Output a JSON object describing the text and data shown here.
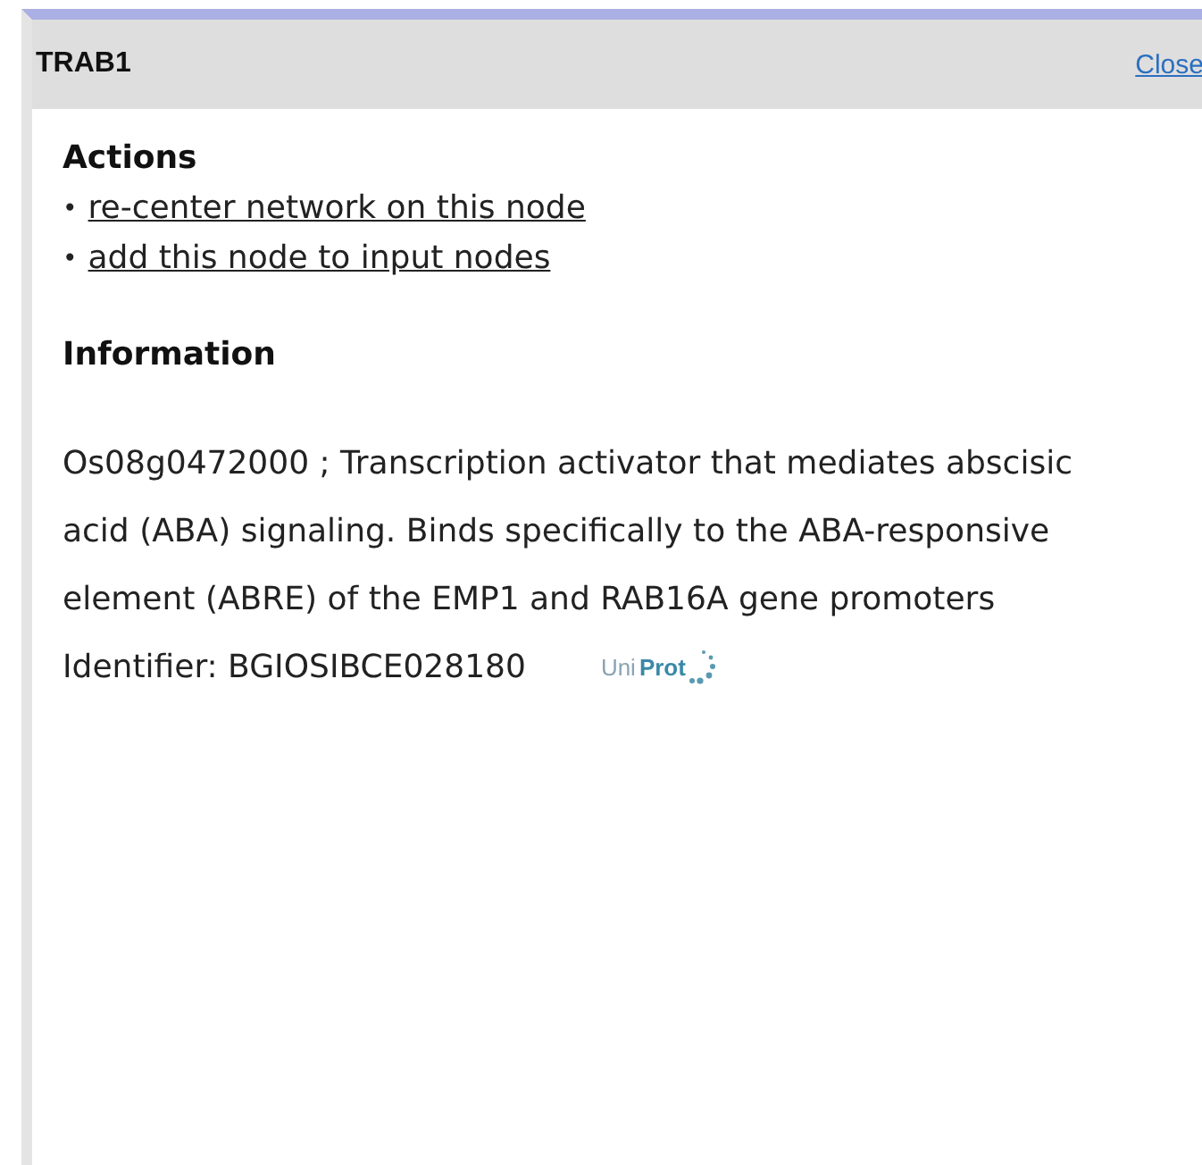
{
  "panel": {
    "title": "TRAB1",
    "close_link": "Close"
  },
  "actions": {
    "heading": "Actions",
    "bullet": "•",
    "links": [
      "re-center network on this node",
      "add this node to input nodes"
    ]
  },
  "information": {
    "heading": "Information",
    "description": "Os08g0472000 ; Transcription activator that mediates abscisic acid (ABA) signaling. Binds specifically to the ABA-responsive element (ABRE) of the EMP1 and RAB16A gene promoters",
    "identifier": "Identifier: BGIOSIBCE028180",
    "logo": {
      "part_1": "Uni",
      "part_2": "Prot"
    }
  }
}
